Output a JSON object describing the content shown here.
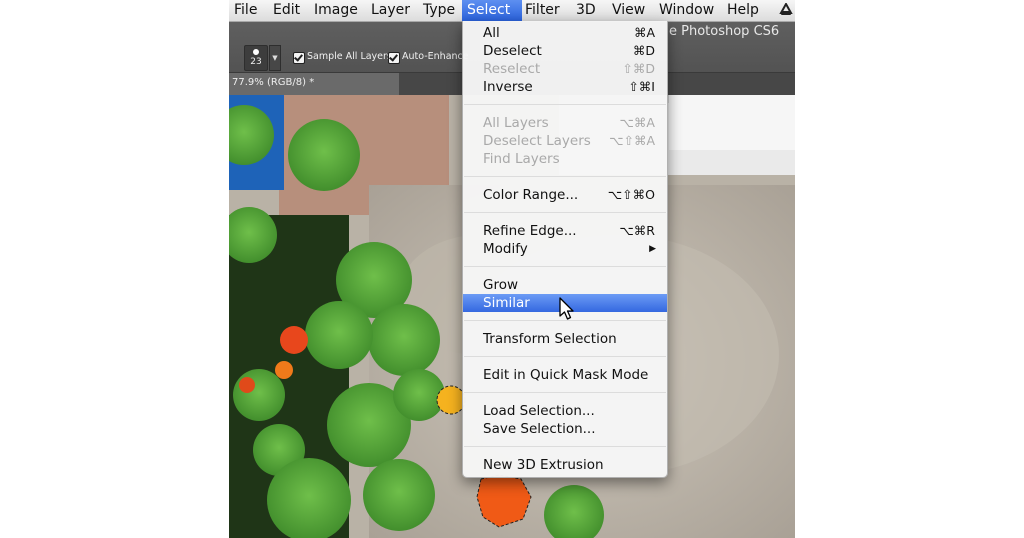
{
  "menubar": {
    "items": [
      "File",
      "Edit",
      "Image",
      "Layer",
      "Type",
      "Select",
      "Filter",
      "3D",
      "View",
      "Window",
      "Help"
    ],
    "active": "Select"
  },
  "app": {
    "title": "e Photoshop CS6"
  },
  "options_bar": {
    "brush_size": "23",
    "sample_all_layers_label": "Sample All Layers",
    "sample_all_layers_checked": true,
    "auto_enhance_label": "Auto-Enhance",
    "auto_enhance_checked": true
  },
  "document": {
    "tab_label": "77.9% (RGB/8) *"
  },
  "select_menu": {
    "items": [
      {
        "label": "All",
        "shortcut": "⌘A",
        "enabled": true
      },
      {
        "label": "Deselect",
        "shortcut": "⌘D",
        "enabled": true
      },
      {
        "label": "Reselect",
        "shortcut": "⇧⌘D",
        "enabled": false
      },
      {
        "label": "Inverse",
        "shortcut": "⇧⌘I",
        "enabled": true
      },
      {
        "label": "All Layers",
        "shortcut": "⌥⌘A",
        "enabled": false
      },
      {
        "label": "Deselect Layers",
        "shortcut": "⌥⇧⌘A",
        "enabled": false
      },
      {
        "label": "Find Layers",
        "shortcut": "",
        "enabled": false
      },
      {
        "label": "Color Range...",
        "shortcut": "⌥⇧⌘O",
        "enabled": true
      },
      {
        "label": "Refine Edge...",
        "shortcut": "⌥⌘R",
        "enabled": true
      },
      {
        "label": "Modify",
        "shortcut": "",
        "submenu": true,
        "enabled": true
      },
      {
        "label": "Grow",
        "shortcut": "",
        "enabled": true
      },
      {
        "label": "Similar",
        "shortcut": "",
        "enabled": true,
        "highlighted": true
      },
      {
        "label": "Transform Selection",
        "shortcut": "",
        "enabled": true
      },
      {
        "label": "Edit in Quick Mask Mode",
        "shortcut": "",
        "enabled": true
      },
      {
        "label": "Load Selection...",
        "shortcut": "",
        "enabled": true
      },
      {
        "label": "Save Selection...",
        "shortcut": "",
        "enabled": true
      },
      {
        "label": "New 3D Extrusion",
        "shortcut": "",
        "enabled": true
      }
    ]
  },
  "colors": {
    "menu_highlight": "#3468e0",
    "disabled_text": "#a9a9a9",
    "options_bar_bg": "#535353"
  }
}
